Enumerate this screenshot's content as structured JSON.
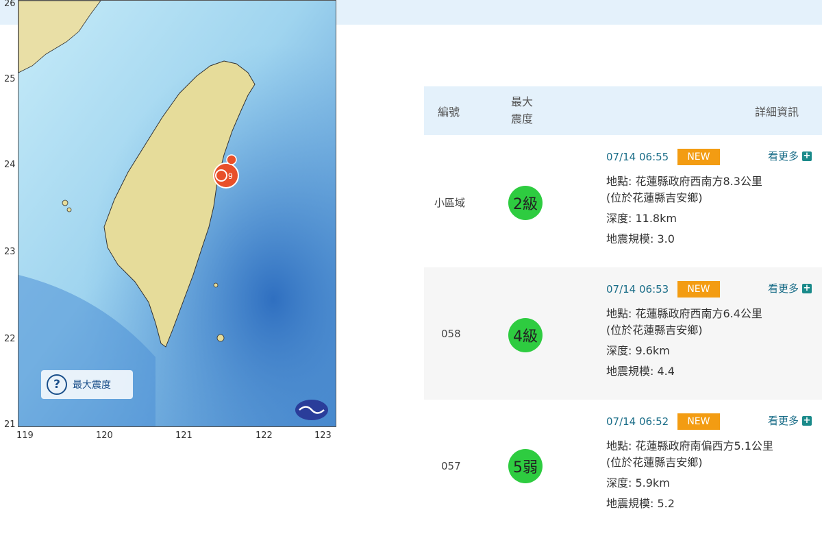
{
  "map": {
    "lat_labels": [
      "26",
      "25",
      "24",
      "23",
      "22",
      "21"
    ],
    "lon_labels": [
      "119",
      "120",
      "121",
      "122",
      "123"
    ],
    "epicenter_label": "9",
    "legend_label": "最大震度",
    "colors": {
      "sea": "#b8e2f5",
      "deep_sea": "#4a8fd4",
      "land": "#e8dea0",
      "epicenter": "#e8502a"
    }
  },
  "table": {
    "headers": {
      "id": "編號",
      "intensity_line1": "最大",
      "intensity_line2": "震度",
      "details": "詳細資訊"
    },
    "rows": [
      {
        "id": "小區域",
        "intensity": "2級",
        "time": "07/14 06:55",
        "new": "NEW",
        "more": "看更多",
        "location1": "地點: 花蓮縣政府西南方8.3公里",
        "location2": "(位於花蓮縣吉安鄉)",
        "depth": "深度: 11.8km",
        "magnitude": "地震規模: 3.0"
      },
      {
        "id": "058",
        "intensity": "4級",
        "time": "07/14 06:53",
        "new": "NEW",
        "more": "看更多",
        "location1": "地點: 花蓮縣政府西南方6.4公里",
        "location2": "(位於花蓮縣吉安鄉)",
        "depth": "深度: 9.6km",
        "magnitude": "地震規模: 4.4"
      },
      {
        "id": "057",
        "intensity": "5弱",
        "time": "07/14 06:52",
        "new": "NEW",
        "more": "看更多",
        "location1": "地點: 花蓮縣政府南偏西方5.1公里",
        "location2": "(位於花蓮縣吉安鄉)",
        "depth": "深度: 5.9km",
        "magnitude": "地震規模: 5.2"
      }
    ]
  }
}
